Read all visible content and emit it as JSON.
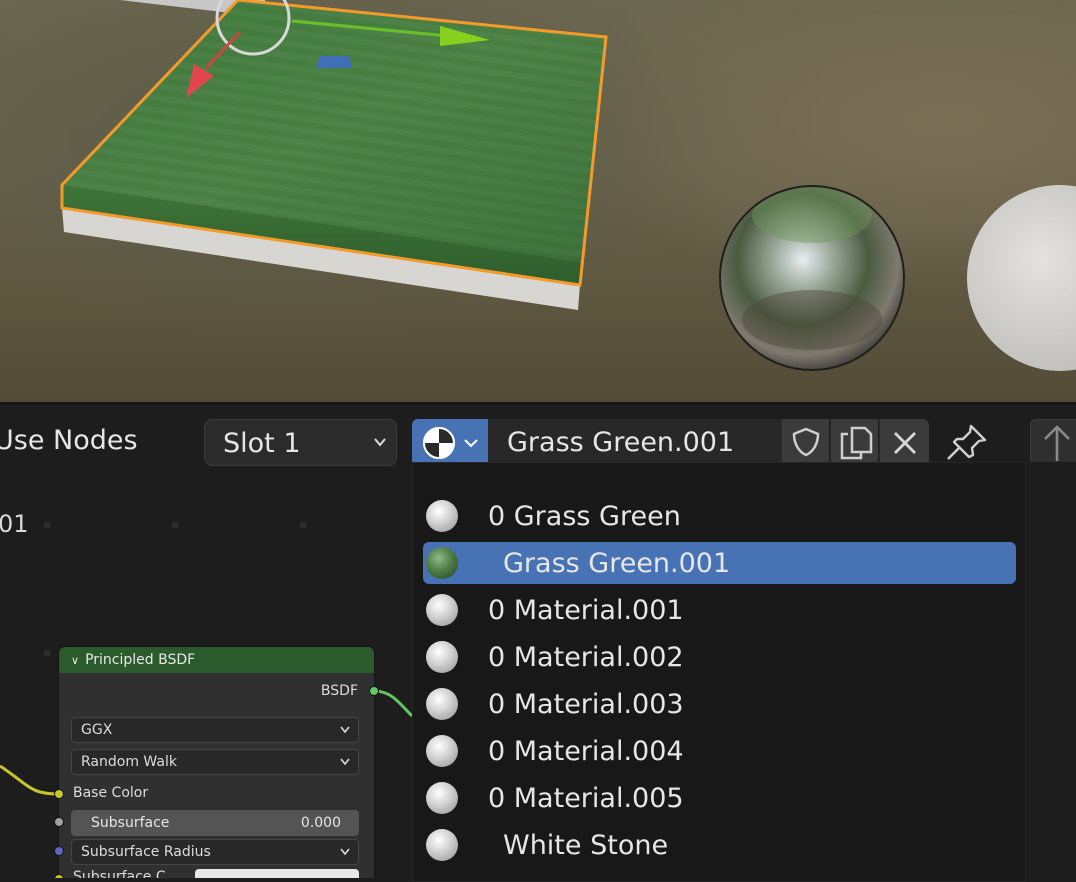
{
  "header": {
    "use_nodes_label": "Use Nodes",
    "slot_label": "Slot 1",
    "material_name": "Grass Green.001",
    "buttons": [
      "fake-user-shield-icon",
      "duplicate-icon",
      "unlink-x-icon",
      "pin-icon",
      "parent-arrow-icon"
    ]
  },
  "editor": {
    "partial_label": "01",
    "node": {
      "title": "Principled BSDF",
      "output_label": "BSDF",
      "distribution": "GGX",
      "subsurface_method": "Random Walk",
      "base_color_label": "Base Color",
      "subsurface_label": "Subsurface",
      "subsurface_value": "0.000",
      "subsurface_radius_label": "Subsurface Radius",
      "subsurface_color_label": "Subsurface C"
    }
  },
  "materials": {
    "items": [
      {
        "label": "0 Grass Green",
        "selected": false
      },
      {
        "label": "Grass Green.001",
        "selected": true
      },
      {
        "label": "0 Material.001",
        "selected": false
      },
      {
        "label": "0 Material.002",
        "selected": false
      },
      {
        "label": "0 Material.003",
        "selected": false
      },
      {
        "label": "0 Material.004",
        "selected": false
      },
      {
        "label": "0 Material.005",
        "selected": false
      },
      {
        "label": "White Stone",
        "selected": false
      }
    ]
  },
  "colors": {
    "accent": "#4772b3",
    "node_header": "#2b5a2c",
    "selection_outline": "#f39b2a",
    "socket_yellow": "#c7c729",
    "socket_grey": "#a1a1a1",
    "socket_blue": "#6363c7",
    "socket_green": "#63c763"
  }
}
